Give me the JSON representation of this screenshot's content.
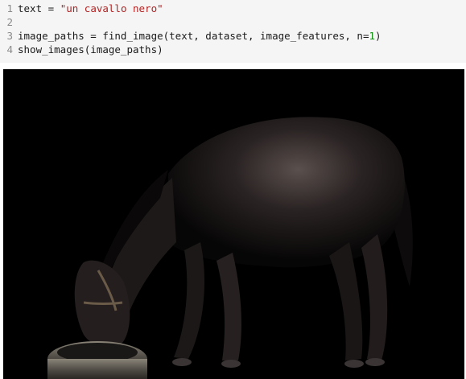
{
  "code_cell": {
    "lines": [
      {
        "num": "1",
        "parts": [
          {
            "t": "text = ",
            "k": "plain"
          },
          {
            "t": "\"un cavallo nero\"",
            "k": "str"
          }
        ]
      },
      {
        "num": "2",
        "parts": []
      },
      {
        "num": "3",
        "parts": [
          {
            "t": "image_paths = find_image(text, dataset, image_features, n=",
            "k": "plain"
          },
          {
            "t": "1",
            "k": "num"
          },
          {
            "t": ")",
            "k": "plain"
          }
        ]
      },
      {
        "num": "4",
        "parts": [
          {
            "t": "show_images(image_paths)",
            "k": "plain"
          }
        ]
      }
    ]
  },
  "output": {
    "image_subject": "black horse eating from a tire on black background"
  },
  "colors": {
    "string": "#b22222",
    "number": "#0a8a0a",
    "cell_bg": "#f5f5f5",
    "image_bg": "#000000"
  }
}
